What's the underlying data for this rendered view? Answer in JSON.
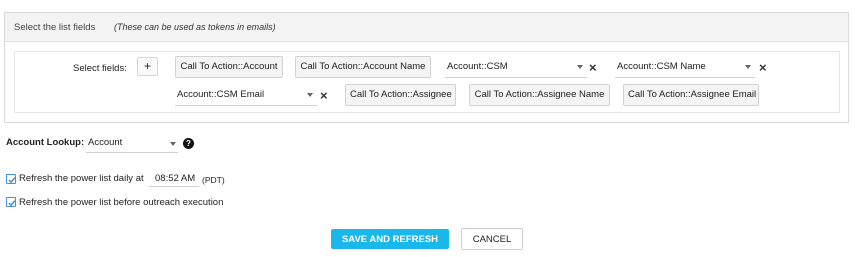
{
  "panel": {
    "title": "Select the list fields",
    "hint": "(These can be used as tokens in emails)"
  },
  "fields": {
    "label": "Select fields:",
    "add_button": "+",
    "items": [
      {
        "label": "Call To Action::Account"
      },
      {
        "label": "Call To Action::Account Name"
      },
      {
        "label": "Account::CSM"
      },
      {
        "label": "Account::CSM Name"
      },
      {
        "label": "Account::CSM Email"
      },
      {
        "label": "Call To Action::Assignee"
      },
      {
        "label": "Call To Action::Assignee Name"
      },
      {
        "label": "Call To Action::Assignee Email"
      }
    ],
    "remove_icon": "close-icon"
  },
  "lookup": {
    "label": "Account Lookup:",
    "value": "Account",
    "help_icon": "?"
  },
  "refresh_daily": {
    "checked": true,
    "label": "Refresh the power list daily at",
    "time": "08:52 AM",
    "timezone": "(PDT)"
  },
  "refresh_before": {
    "checked": true,
    "label": "Refresh the power list before outreach execution"
  },
  "actions": {
    "save": "SAVE AND REFRESH",
    "cancel": "CANCEL"
  },
  "colors": {
    "accent": "#1ab7ea",
    "checkbox": "#4a90d9"
  }
}
